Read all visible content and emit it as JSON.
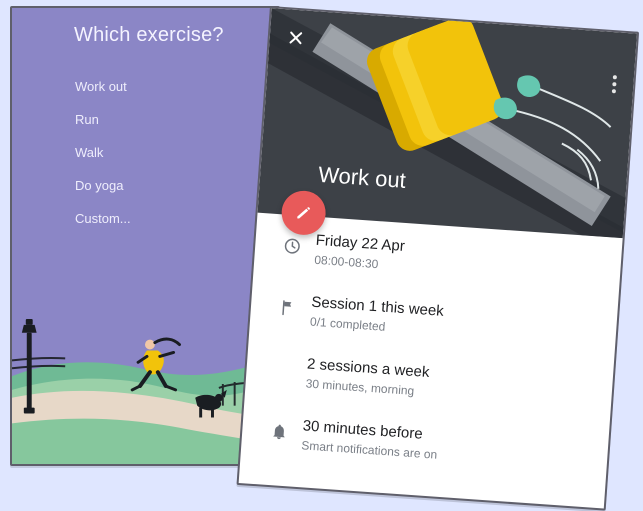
{
  "left_screen": {
    "title": "Which exercise?",
    "options": [
      "Work out",
      "Run",
      "Walk",
      "Do yoga",
      "Custom..."
    ]
  },
  "right_screen": {
    "title": "Work out",
    "details": [
      {
        "icon": "clock-icon",
        "primary": "Friday 22 Apr",
        "secondary": "08:00-08:30"
      },
      {
        "icon": "flag-icon",
        "primary": "Session 1 this week",
        "secondary": "0/1 completed"
      },
      {
        "icon": "",
        "primary": "2 sessions a week",
        "secondary": "30 minutes, morning"
      },
      {
        "icon": "bell-icon",
        "primary": "30 minutes before",
        "secondary": "Smart notifications are on"
      }
    ]
  },
  "icons": {
    "close": "close-icon",
    "more": "more-vert-icon",
    "edit": "edit-icon"
  },
  "colors": {
    "accent": "#e85a5a",
    "left_bg": "#8b86c6",
    "card_header": "#3d4147"
  }
}
